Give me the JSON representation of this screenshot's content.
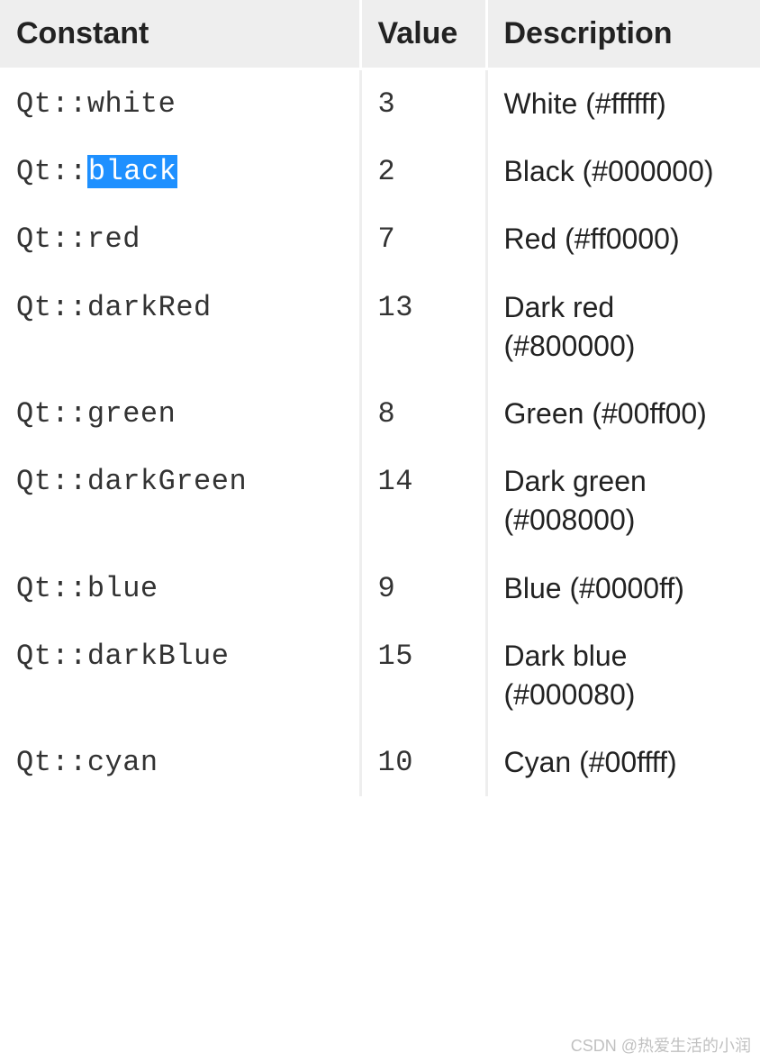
{
  "headers": {
    "constant": "Constant",
    "value": "Value",
    "description": "Description"
  },
  "rows": [
    {
      "prefix": "Qt::",
      "name": "white",
      "selected": false,
      "value": "3",
      "desc": "White (#ffffff)"
    },
    {
      "prefix": "Qt::",
      "name": "black",
      "selected": true,
      "value": "2",
      "desc": "Black (#000000)"
    },
    {
      "prefix": "Qt::",
      "name": "red",
      "selected": false,
      "value": "7",
      "desc": "Red (#ff0000)"
    },
    {
      "prefix": "Qt::",
      "name": "darkRed",
      "selected": false,
      "value": "13",
      "desc": "Dark red (#800000)"
    },
    {
      "prefix": "Qt::",
      "name": "green",
      "selected": false,
      "value": "8",
      "desc": "Green (#00ff00)"
    },
    {
      "prefix": "Qt::",
      "name": "darkGreen",
      "selected": false,
      "value": "14",
      "desc": "Dark green (#008000)"
    },
    {
      "prefix": "Qt::",
      "name": "blue",
      "selected": false,
      "value": "9",
      "desc": "Blue (#0000ff)"
    },
    {
      "prefix": "Qt::",
      "name": "darkBlue",
      "selected": false,
      "value": "15",
      "desc": "Dark blue (#000080)"
    },
    {
      "prefix": "Qt::",
      "name": "cyan",
      "selected": false,
      "value": "10",
      "desc": "Cyan (#00ffff)"
    }
  ],
  "watermark": "CSDN @热爱生活的小润"
}
